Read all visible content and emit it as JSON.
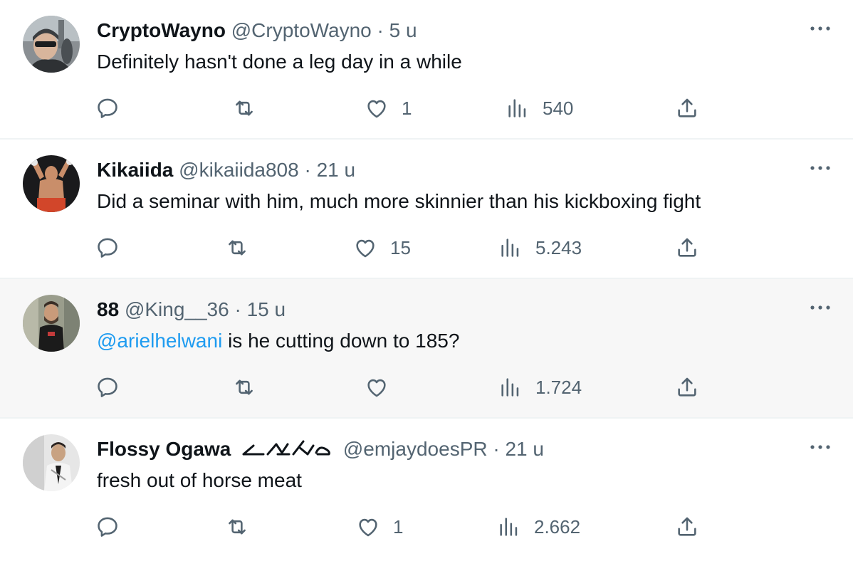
{
  "replies": [
    {
      "name": "CryptoWayno",
      "handle": "@CryptoWayno",
      "separator": "·",
      "time": "5 u",
      "text": "Definitely hasn't done a leg day in a while",
      "likes": "1",
      "views": "540"
    },
    {
      "name": "Kikaiida",
      "handle": "@kikaiida808",
      "separator": "·",
      "time": "21 u",
      "text": "Did a seminar with him, much more skinnier than his kickboxing fight",
      "likes": "15",
      "views": "5.243"
    },
    {
      "name": "88",
      "handle": "@King__36",
      "separator": "·",
      "time": "15 u",
      "mention": "@arielhelwani",
      "text": " is he cutting down to 185?",
      "likes": "",
      "views": "1.724"
    },
    {
      "name": "Flossy Ogawa",
      "handle": "@emjaydoesPR",
      "separator": "·",
      "time": "21 u",
      "text": "fresh out of horse meat",
      "likes": "1",
      "views": "2.662"
    }
  ],
  "colors": {
    "text": "#0f1419",
    "secondary": "#536471",
    "link": "#1d9bf0",
    "highlight_bg": "#f7f7f7",
    "divider": "#eff3f4"
  },
  "icons": [
    "reply-icon",
    "retweet-icon",
    "like-icon",
    "views-icon",
    "share-icon",
    "more-icon"
  ]
}
